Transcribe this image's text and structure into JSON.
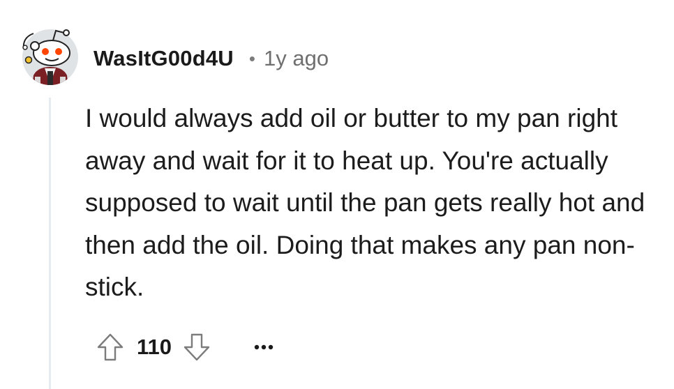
{
  "comment": {
    "author": "WasItG00d4U",
    "separator": "•",
    "age": "1y ago",
    "body": "I would always add oil or butter to my pan right away and wait for it to heat up. You're actually supposed to wait until the pan gets really hot and then add the oil. Doing that makes any pan non-stick.",
    "score": "110"
  },
  "icons": {
    "avatar": "snoo-avatar",
    "upvote": "arrow-up-outline-icon",
    "downvote": "arrow-down-outline-icon",
    "more": "ellipsis-icon"
  },
  "colors": {
    "text": "#1c1c1c",
    "meta": "#6f6f6f",
    "icon_stroke": "#7c7c7c",
    "thread_line": "#e5ebee",
    "avatar_bg": "#dfe3e6"
  }
}
